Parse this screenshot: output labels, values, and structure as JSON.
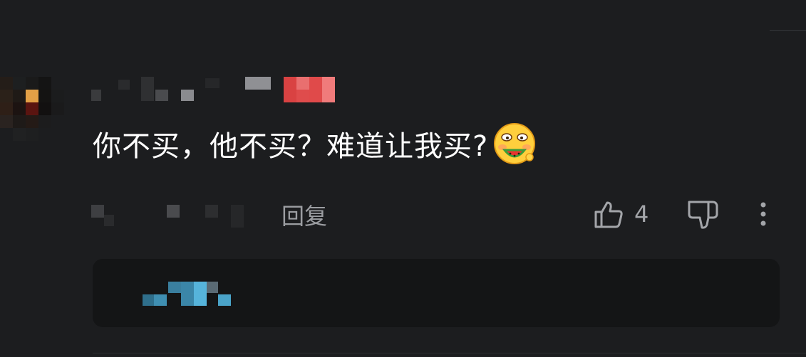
{
  "comment": {
    "text": "你不买，他不买？难道让我买?",
    "emoji_icon": "watermelon-eating-face-emoji"
  },
  "actions": {
    "reply_label": "回复",
    "like_count": "4",
    "like_icon": "thumbs-up-icon",
    "dislike_icon": "thumbs-down-icon",
    "more_icon": "more-vertical-icon"
  },
  "colors": {
    "background": "#1c1d1f",
    "reply_box": "#141516",
    "text": "#ffffff",
    "secondary_text": "#9b9da1",
    "badge_red": "#e04a4a",
    "reply_blur_blue": "#4aa3c8"
  }
}
